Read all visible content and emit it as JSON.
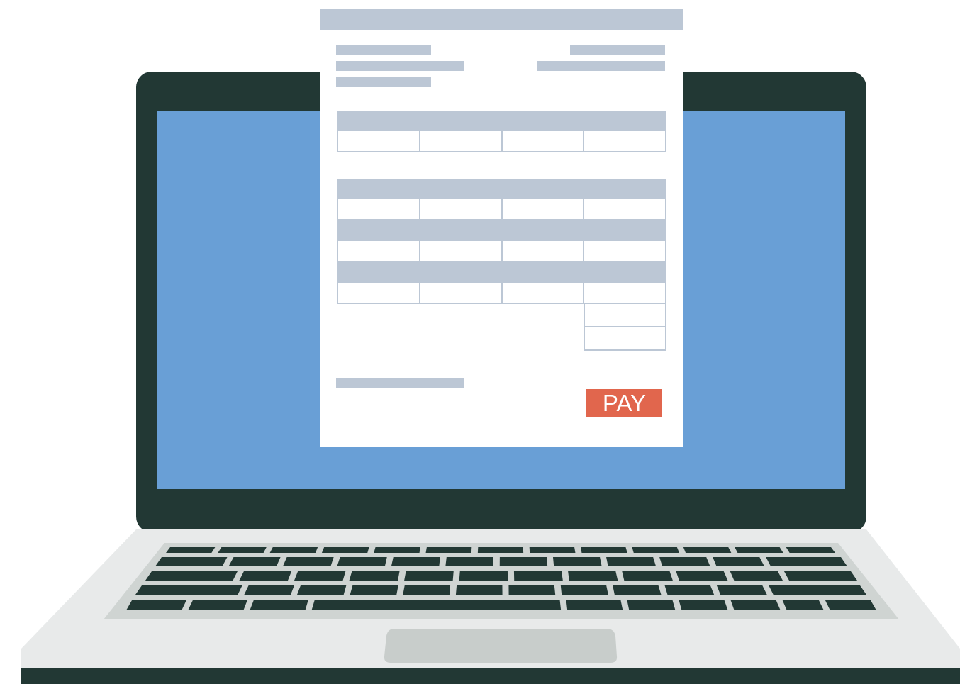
{
  "invoice": {
    "pay_label": "PAY"
  },
  "colors": {
    "bezel": "#223834",
    "screen": "#699fd6",
    "paper": "#ffffff",
    "placeholder": "#bcc7d5",
    "pay_button": "#e1664d",
    "laptop_base": "#e8eaea",
    "keyboard_well": "#cfd4d2",
    "keys": "#223834",
    "touchpad": "#c8cdcb"
  }
}
